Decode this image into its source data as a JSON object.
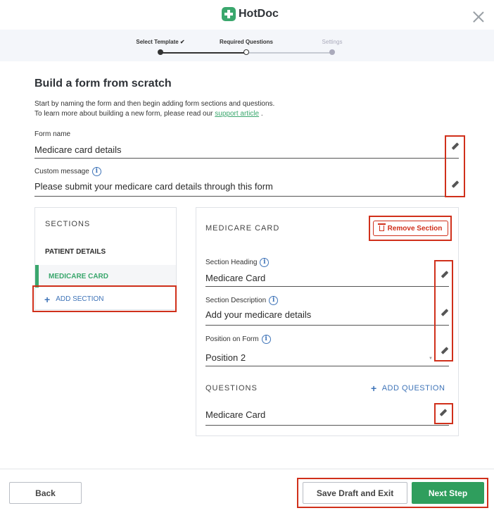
{
  "app": {
    "name": "HotDoc"
  },
  "stepper": {
    "steps": [
      {
        "label": "Select Template ✔",
        "state": "done"
      },
      {
        "label": "Required Questions",
        "state": "current"
      },
      {
        "label": "Settings",
        "state": "upcoming"
      }
    ]
  },
  "page": {
    "title": "Build a form from scratch",
    "intro_line1": "Start by naming the form and then begin adding form sections and questions.",
    "intro_line2_prefix": "To learn more about building a new form, please read our ",
    "intro_link": "support article",
    "intro_line2_suffix": " ."
  },
  "form": {
    "name_label": "Form name",
    "name_value": "Medicare card details",
    "message_label": "Custom message",
    "message_value": "Please submit your medicare card details through this form"
  },
  "sections": {
    "title": "SECTIONS",
    "items": [
      {
        "label": "PATIENT DETAILS",
        "active": false
      },
      {
        "label": "MEDICARE CARD",
        "active": true
      }
    ],
    "add_label": "ADD SECTION"
  },
  "section_detail": {
    "title": "MEDICARE CARD",
    "remove_label": "Remove Section",
    "heading_label": "Section Heading",
    "heading_value": "Medicare Card",
    "description_label": "Section Description",
    "description_value": "Add your medicare details",
    "position_label": "Position on Form",
    "position_value": "Position 2",
    "questions_title": "QUESTIONS",
    "add_question_label": "ADD QUESTION",
    "questions": [
      {
        "label": "Medicare Card"
      }
    ]
  },
  "footer": {
    "back_label": "Back",
    "draft_label": "Save Draft and Exit",
    "next_label": "Next Step"
  },
  "colors": {
    "brand_green": "#3aa76d",
    "link_blue": "#3f74b8",
    "highlight_red": "#d0301b",
    "next_button": "#2f9e5d"
  }
}
